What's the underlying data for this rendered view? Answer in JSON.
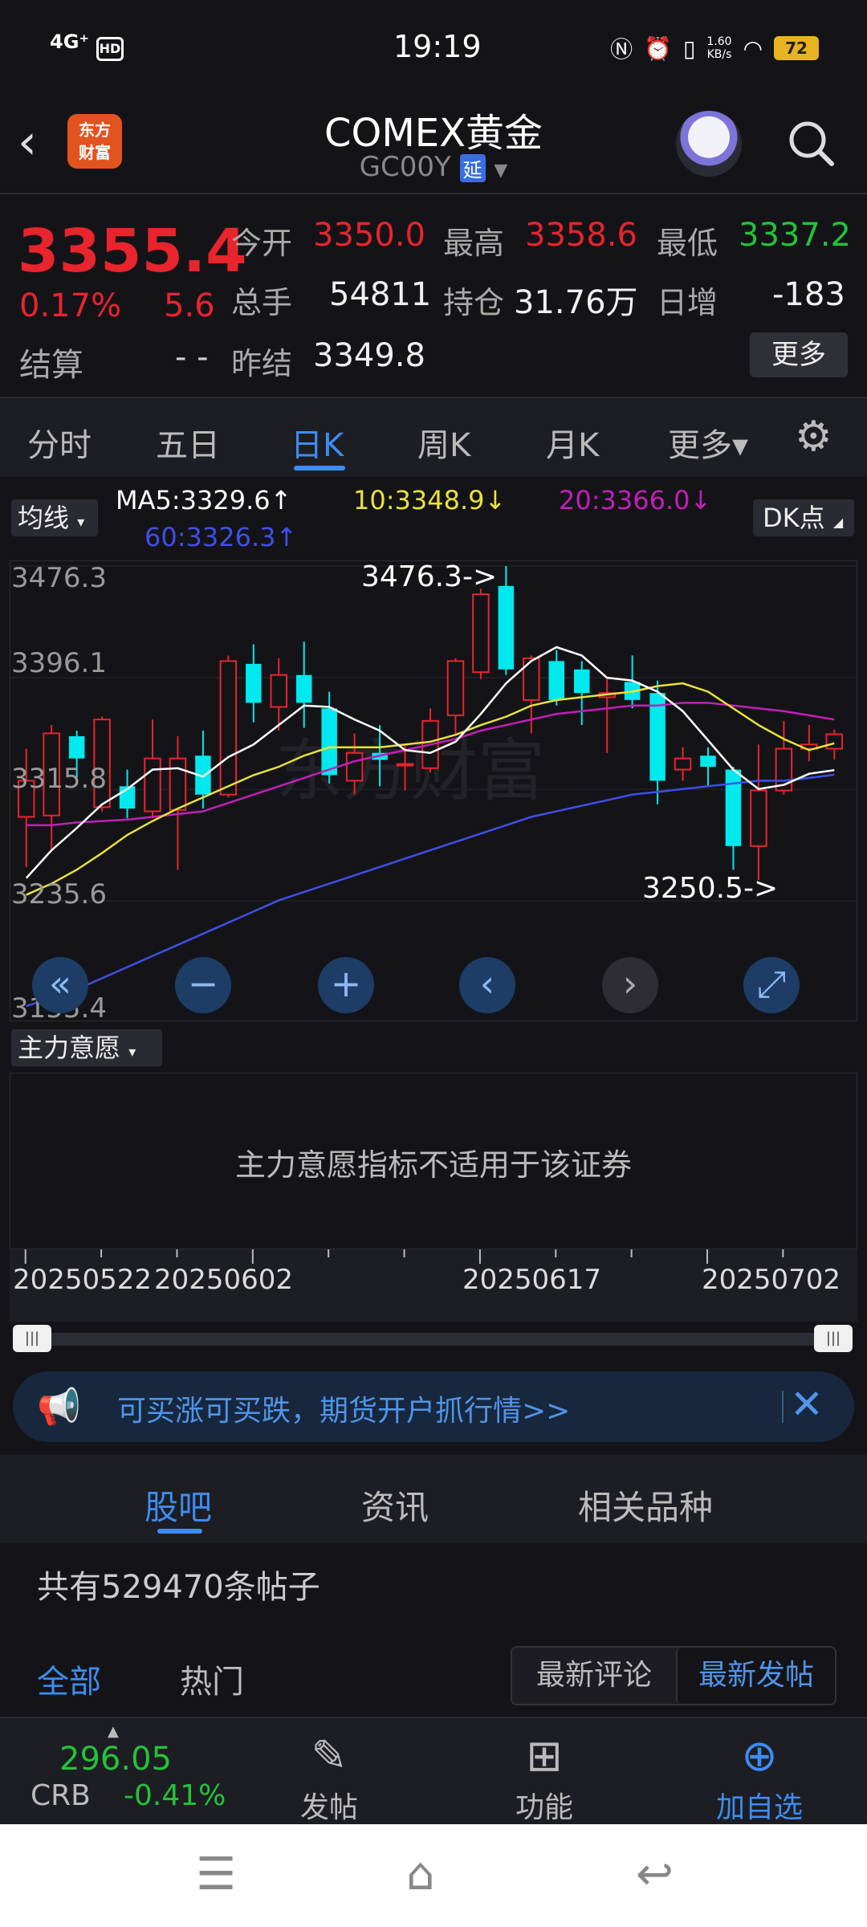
{
  "status_bar": {
    "network": "4G⁺",
    "hd": "HD",
    "time": "19:19",
    "net_speed": "1.60\nKB/s",
    "battery": "72"
  },
  "header": {
    "logo_text": "东方\n财富",
    "title": "COMEX黄金",
    "code": "GC00Y",
    "delay_badge": "延"
  },
  "quote": {
    "price": "3355.4",
    "pct_change": "0.17%",
    "change": "5.6",
    "open_label": "今开",
    "open": "3350.0",
    "high_label": "最高",
    "high": "3358.6",
    "low_label": "最低",
    "low": "3337.2",
    "volume_label": "总手",
    "volume": "54811",
    "oi_label": "持仓",
    "oi": "31.76万",
    "daily_inc_label": "日增",
    "daily_inc": "-183",
    "settle_label": "结算",
    "settle": "- -",
    "prev_settle_label": "昨结",
    "prev_settle": "3349.8",
    "more_btn": "更多"
  },
  "period_tabs": [
    "分时",
    "五日",
    "日K",
    "周K",
    "月K",
    "更多▾"
  ],
  "chart_controls": {
    "ma_button": "均线",
    "ma5": "MA5:3329.6↑",
    "ma10": "10:3348.9↓",
    "ma20": "20:3366.0↓",
    "ma60": "60:3326.3↑",
    "dk_button": "DK点",
    "indicator_button": "主力意愿",
    "indicator_msg": "主力意愿指标不适用于该证券",
    "nav_buttons": [
      "«",
      "−",
      "+",
      "‹",
      "›",
      "⤢"
    ]
  },
  "chart_data": {
    "type": "candlestick",
    "y_ticks": [
      "3476.3",
      "3396.1",
      "3315.8",
      "3235.6",
      "3155.4"
    ],
    "ylim": [
      3155.4,
      3476.3
    ],
    "annotations": [
      "3476.3->",
      "3250.5->"
    ],
    "x_ticks": [
      "20250522",
      "20250602",
      "20250617",
      "20250702"
    ],
    "candles": [
      {
        "o": 3296,
        "c": 3322,
        "h": 3345,
        "l": 3260
      },
      {
        "o": 3297,
        "c": 3356,
        "h": 3362,
        "l": 3272
      },
      {
        "o": 3354,
        "c": 3338,
        "h": 3358,
        "l": 3320
      },
      {
        "o": 3303,
        "c": 3366,
        "h": 3368,
        "l": 3300
      },
      {
        "o": 3318,
        "c": 3302,
        "h": 3330,
        "l": 3295
      },
      {
        "o": 3300,
        "c": 3338,
        "h": 3366,
        "l": 3295
      },
      {
        "o": 3301,
        "c": 3338,
        "h": 3354,
        "l": 3258
      },
      {
        "o": 3340,
        "c": 3312,
        "h": 3358,
        "l": 3302
      },
      {
        "o": 3312,
        "c": 3408,
        "h": 3412,
        "l": 3310
      },
      {
        "o": 3406,
        "c": 3378,
        "h": 3420,
        "l": 3364
      },
      {
        "o": 3375,
        "c": 3398,
        "h": 3410,
        "l": 3358
      },
      {
        "o": 3398,
        "c": 3378,
        "h": 3422,
        "l": 3360
      },
      {
        "o": 3374,
        "c": 3326,
        "h": 3386,
        "l": 3320
      },
      {
        "o": 3322,
        "c": 3342,
        "h": 3356,
        "l": 3312
      },
      {
        "o": 3342,
        "c": 3337,
        "h": 3362,
        "l": 3318
      },
      {
        "o": 3334,
        "c": 3334,
        "h": 3348,
        "l": 3315
      },
      {
        "o": 3331,
        "c": 3365,
        "h": 3374,
        "l": 3328
      },
      {
        "o": 3369,
        "c": 3408,
        "h": 3410,
        "l": 3355
      },
      {
        "o": 3400,
        "c": 3456,
        "h": 3460,
        "l": 3395
      },
      {
        "o": 3462,
        "c": 3402,
        "h": 3476.3,
        "l": 3398
      },
      {
        "o": 3380,
        "c": 3410,
        "h": 3412,
        "l": 3356
      },
      {
        "o": 3408,
        "c": 3380,
        "h": 3416,
        "l": 3376
      },
      {
        "o": 3402,
        "c": 3385,
        "h": 3408,
        "l": 3362
      },
      {
        "o": 3382,
        "c": 3385,
        "h": 3395,
        "l": 3342
      },
      {
        "o": 3393,
        "c": 3380,
        "h": 3412,
        "l": 3374
      },
      {
        "o": 3385,
        "c": 3322,
        "h": 3394,
        "l": 3305
      },
      {
        "o": 3330,
        "c": 3338,
        "h": 3346,
        "l": 3322
      },
      {
        "o": 3340,
        "c": 3332,
        "h": 3346,
        "l": 3318
      },
      {
        "o": 3330,
        "c": 3275,
        "h": 3332,
        "l": 3258
      },
      {
        "o": 3275,
        "c": 3315,
        "h": 3348,
        "l": 3250.5
      },
      {
        "o": 3315,
        "c": 3345,
        "h": 3365,
        "l": 3312
      },
      {
        "o": 3345,
        "c": 3348,
        "h": 3362,
        "l": 3336
      },
      {
        "o": 3345,
        "c": 3355.4,
        "h": 3358.6,
        "l": 3337.2
      }
    ],
    "ma5": [
      3252,
      3272,
      3288,
      3305,
      3316,
      3330,
      3331,
      3325,
      3339,
      3348,
      3362,
      3376,
      3375,
      3366,
      3358,
      3344,
      3342,
      3350,
      3370,
      3392,
      3408,
      3418,
      3412,
      3396,
      3394,
      3386,
      3372,
      3351,
      3330,
      3316,
      3319,
      3327,
      3329.6
    ],
    "ma10": [
      3240,
      3248,
      3258,
      3270,
      3283,
      3293,
      3302,
      3310,
      3318,
      3326,
      3332,
      3340,
      3346,
      3346,
      3346,
      3348,
      3350,
      3355,
      3362,
      3368,
      3376,
      3380,
      3382,
      3384,
      3386,
      3390,
      3392,
      3386,
      3374,
      3362,
      3352,
      3344,
      3348.9
    ],
    "ma20": [
      3290,
      3290,
      3292,
      3293,
      3294,
      3296,
      3298,
      3300,
      3306,
      3312,
      3318,
      3324,
      3330,
      3336,
      3340,
      3344,
      3348,
      3352,
      3358,
      3362,
      3366,
      3370,
      3372,
      3374,
      3376,
      3376,
      3378,
      3378,
      3376,
      3374,
      3372,
      3369,
      3366.0
    ],
    "ma60": [
      3160,
      3166,
      3172,
      3180,
      3188,
      3196,
      3204,
      3212,
      3220,
      3228,
      3236,
      3242,
      3248,
      3254,
      3260,
      3266,
      3272,
      3278,
      3284,
      3290,
      3296,
      3300,
      3304,
      3308,
      3312,
      3314,
      3316,
      3318,
      3320,
      3322,
      3322,
      3324,
      3326.3
    ]
  },
  "colors": {
    "up": "#e8242d",
    "down": "#00e9ee",
    "ma5": "#ffffff",
    "ma10": "#e8e23a",
    "ma20": "#c21fb8",
    "ma60": "#3f4fe8",
    "accent": "#3d8cf0"
  },
  "ad_banner": {
    "text": "可买涨可买跌，期货开户抓行情>>"
  },
  "section_tabs": [
    "股吧",
    "资讯",
    "相关品种"
  ],
  "forum": {
    "post_count": "共有529470条帖子",
    "filter_all": "全部",
    "filter_hot": "热门",
    "sort_latest_comment": "最新评论",
    "sort_latest_post": "最新发帖"
  },
  "bottom_nav": {
    "crb_value": "296.05",
    "crb_name": "CRB",
    "crb_pct": "-0.41%",
    "post": "发帖",
    "functions": "功能",
    "add_watch": "加自选"
  }
}
